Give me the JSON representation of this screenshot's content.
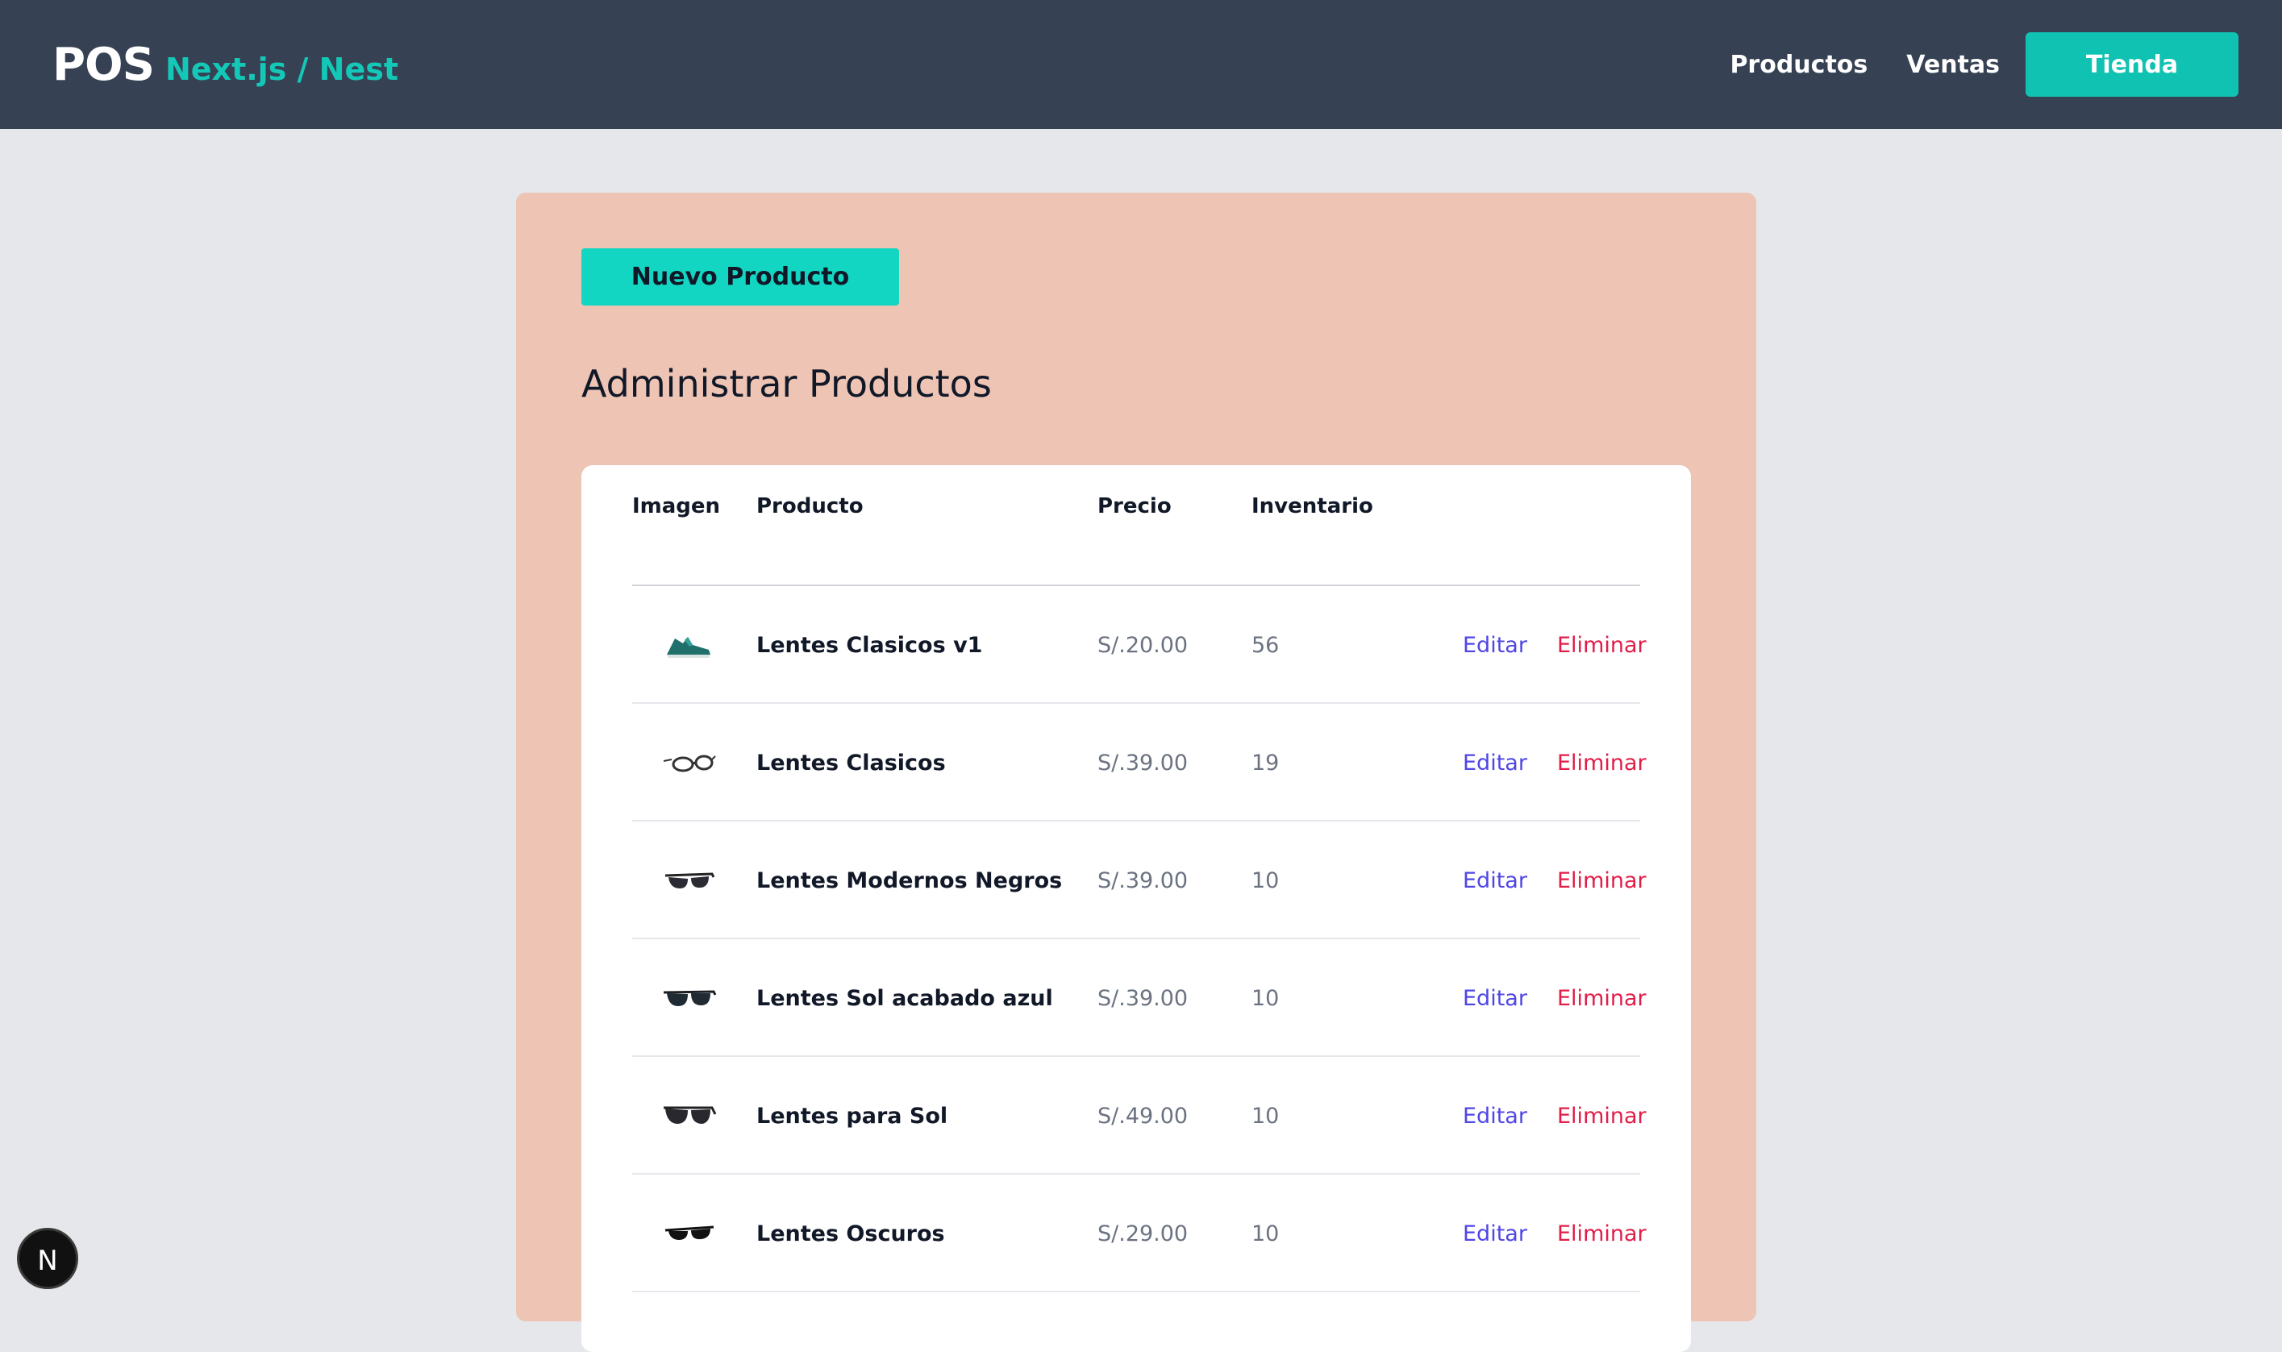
{
  "navbar": {
    "brand_main": "POS",
    "brand_sub": "Next.js / Nest",
    "links": [
      "Productos",
      "Ventas"
    ],
    "cta": "Tienda"
  },
  "admin": {
    "new_button": "Nuevo Producto",
    "title": "Administrar Productos",
    "columns": [
      "Imagen",
      "Producto",
      "Precio",
      "Inventario"
    ],
    "edit_label": "Editar",
    "delete_label": "Eliminar",
    "rows": [
      {
        "name": "Lentes Clasicos v1",
        "price": "S/.20.00",
        "stock": "56",
        "icon": "sneaker-icon"
      },
      {
        "name": "Lentes Clasicos",
        "price": "S/.39.00",
        "stock": "19",
        "icon": "glasses-icon"
      },
      {
        "name": "Lentes Modernos Negros",
        "price": "S/.39.00",
        "stock": "10",
        "icon": "sunglasses-icon"
      },
      {
        "name": "Lentes Sol acabado azul",
        "price": "S/.39.00",
        "stock": "10",
        "icon": "sunglasses-icon"
      },
      {
        "name": "Lentes para Sol",
        "price": "S/.49.00",
        "stock": "10",
        "icon": "sunglasses-icon"
      },
      {
        "name": "Lentes Oscuros",
        "price": "S/.29.00",
        "stock": "10",
        "icon": "sunglasses-icon"
      }
    ]
  },
  "badge": {
    "letter": "N"
  },
  "colors": {
    "navbar": "#364154",
    "accent": "#10c2b1",
    "panel": "#eec4b5",
    "edit": "#4f46e5",
    "delete": "#e11d48"
  }
}
